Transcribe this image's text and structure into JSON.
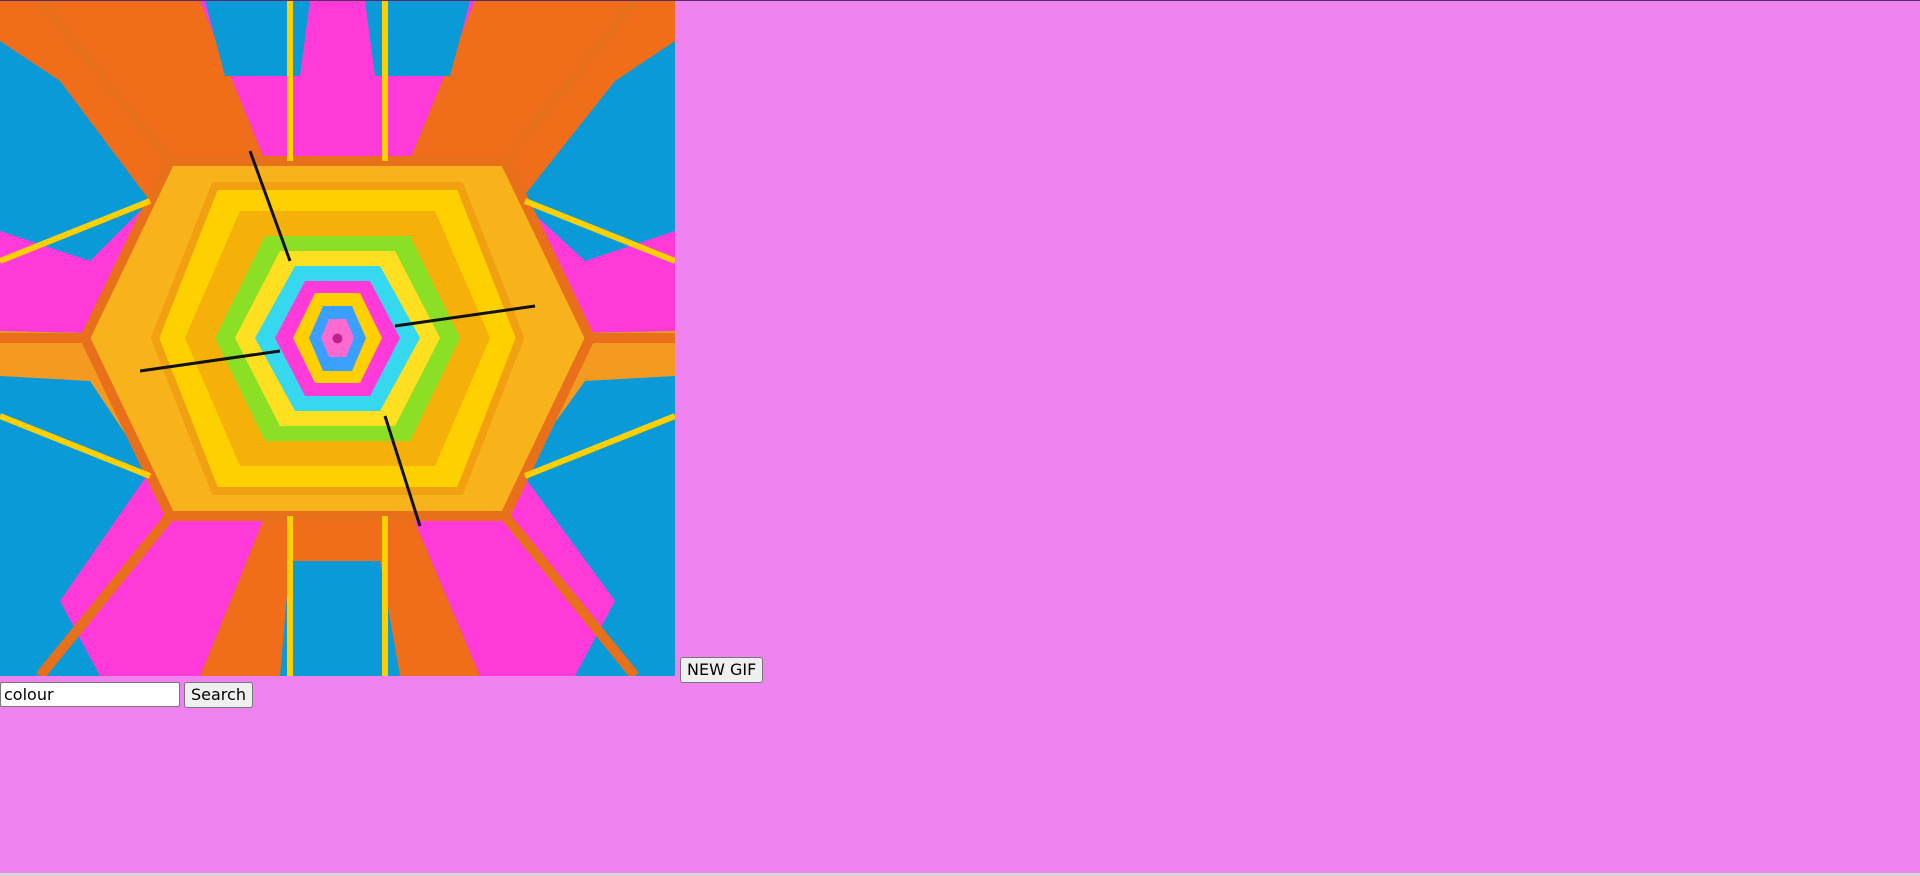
{
  "page": {
    "background_color": "#ee82ee"
  },
  "gif": {
    "description_icon": "kaleidoscope-image"
  },
  "new_gif_button": {
    "label": "NEW GIF"
  },
  "search": {
    "value": "colour",
    "button_label": "Search"
  }
}
